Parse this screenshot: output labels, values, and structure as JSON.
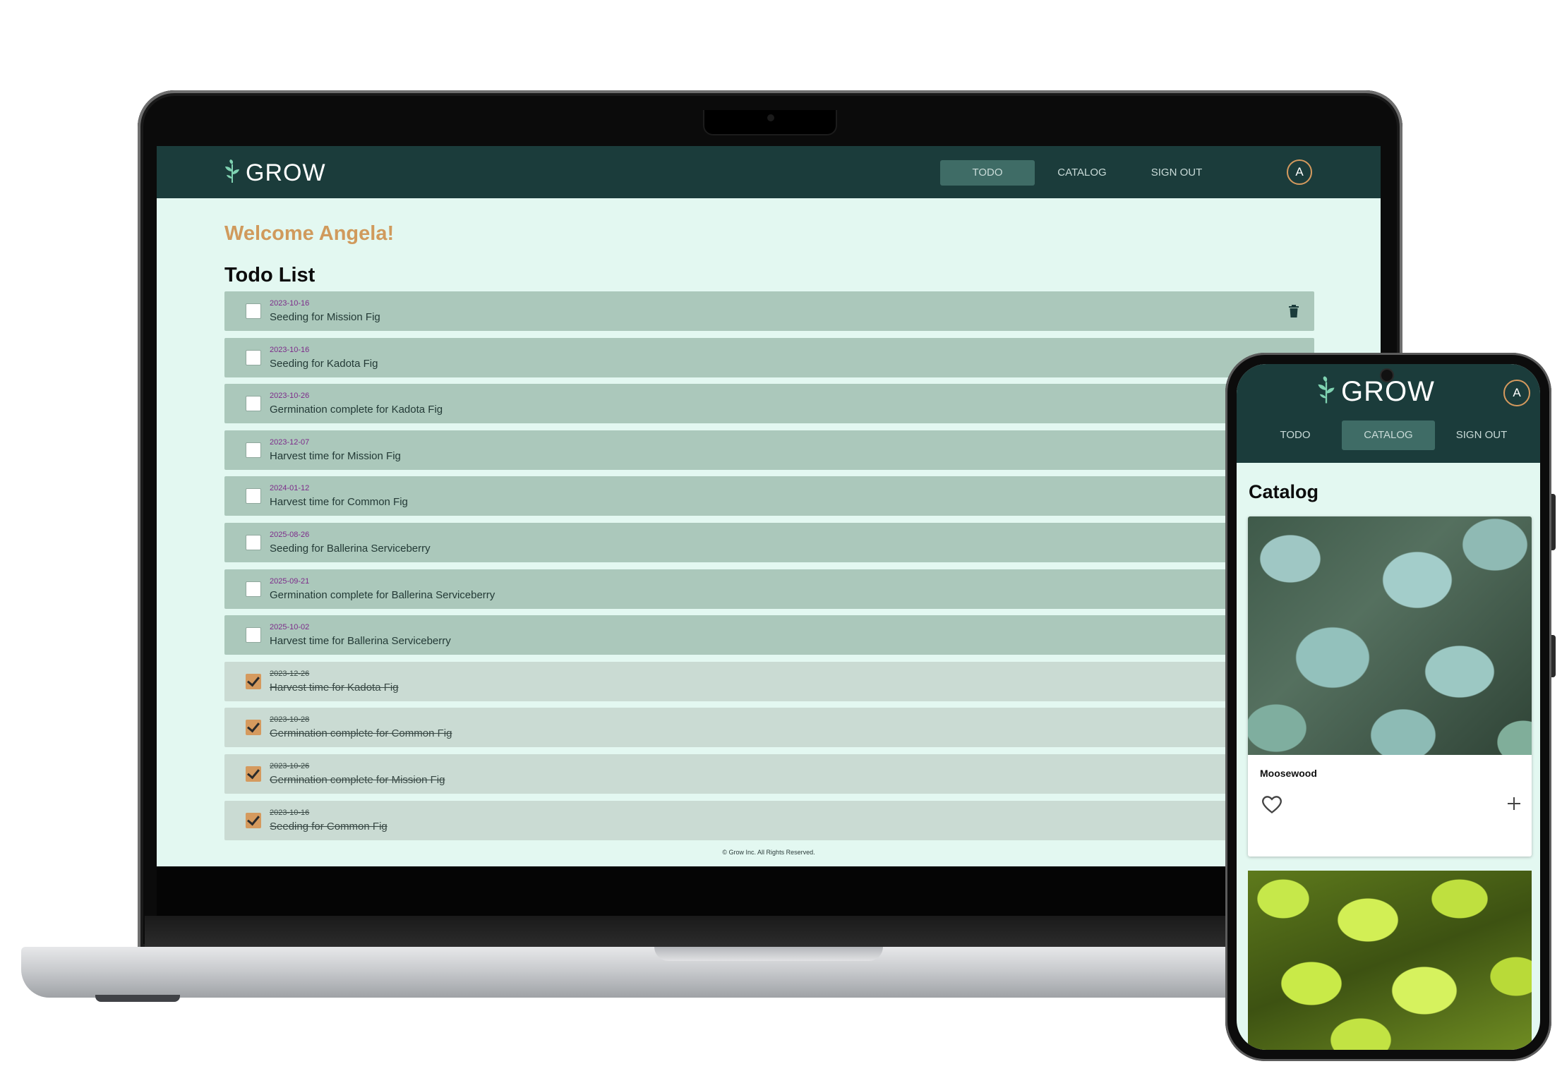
{
  "laptop": {
    "brand": "GROW",
    "nav": {
      "todo": "TODO",
      "catalog": "CATALOG",
      "signout": "SIGN OUT",
      "active": "TODO"
    },
    "avatar_initial": "A",
    "welcome": "Welcome Angela!",
    "list_title": "Todo List",
    "todos": [
      {
        "date": "2023-10-16",
        "text": "Seeding for Mission Fig",
        "done": false
      },
      {
        "date": "2023-10-16",
        "text": "Seeding for Kadota Fig",
        "done": false
      },
      {
        "date": "2023-10-26",
        "text": "Germination complete for Kadota Fig",
        "done": false
      },
      {
        "date": "2023-12-07",
        "text": "Harvest time for Mission Fig",
        "done": false
      },
      {
        "date": "2024-01-12",
        "text": "Harvest time for Common Fig",
        "done": false
      },
      {
        "date": "2025-08-26",
        "text": "Seeding for Ballerina Serviceberry",
        "done": false
      },
      {
        "date": "2025-09-21",
        "text": "Germination complete for Ballerina Serviceberry",
        "done": false
      },
      {
        "date": "2025-10-02",
        "text": "Harvest time for Ballerina Serviceberry",
        "done": false
      },
      {
        "date": "2023-12-26",
        "text": "Harvest time for Kadota Fig",
        "done": true
      },
      {
        "date": "2023-10-28",
        "text": "Germination complete for Common Fig",
        "done": true
      },
      {
        "date": "2023-10-26",
        "text": "Germination complete for Mission Fig",
        "done": true
      },
      {
        "date": "2023-10-16",
        "text": "Seeding for Common Fig",
        "done": true
      }
    ],
    "footer": "© Grow Inc. All Rights Reserved."
  },
  "phone": {
    "brand": "GROW",
    "avatar_initial": "A",
    "nav": {
      "todo": "TODO",
      "catalog": "CATALOG",
      "signout": "SIGN OUT",
      "active": "CATALOG"
    },
    "title": "Catalog",
    "cards": [
      {
        "name": "Moosewood"
      }
    ]
  },
  "colors": {
    "header": "#1b3c3b",
    "page_bg": "#e3f8f1",
    "accent": "#d59a5e",
    "row_pending": "#abc8bb",
    "row_done": "#cadbd3",
    "date_text": "#7d2a8a"
  },
  "icons": [
    "sprout-logo-icon",
    "trash-icon",
    "check-icon",
    "heart-icon",
    "plus-icon"
  ]
}
